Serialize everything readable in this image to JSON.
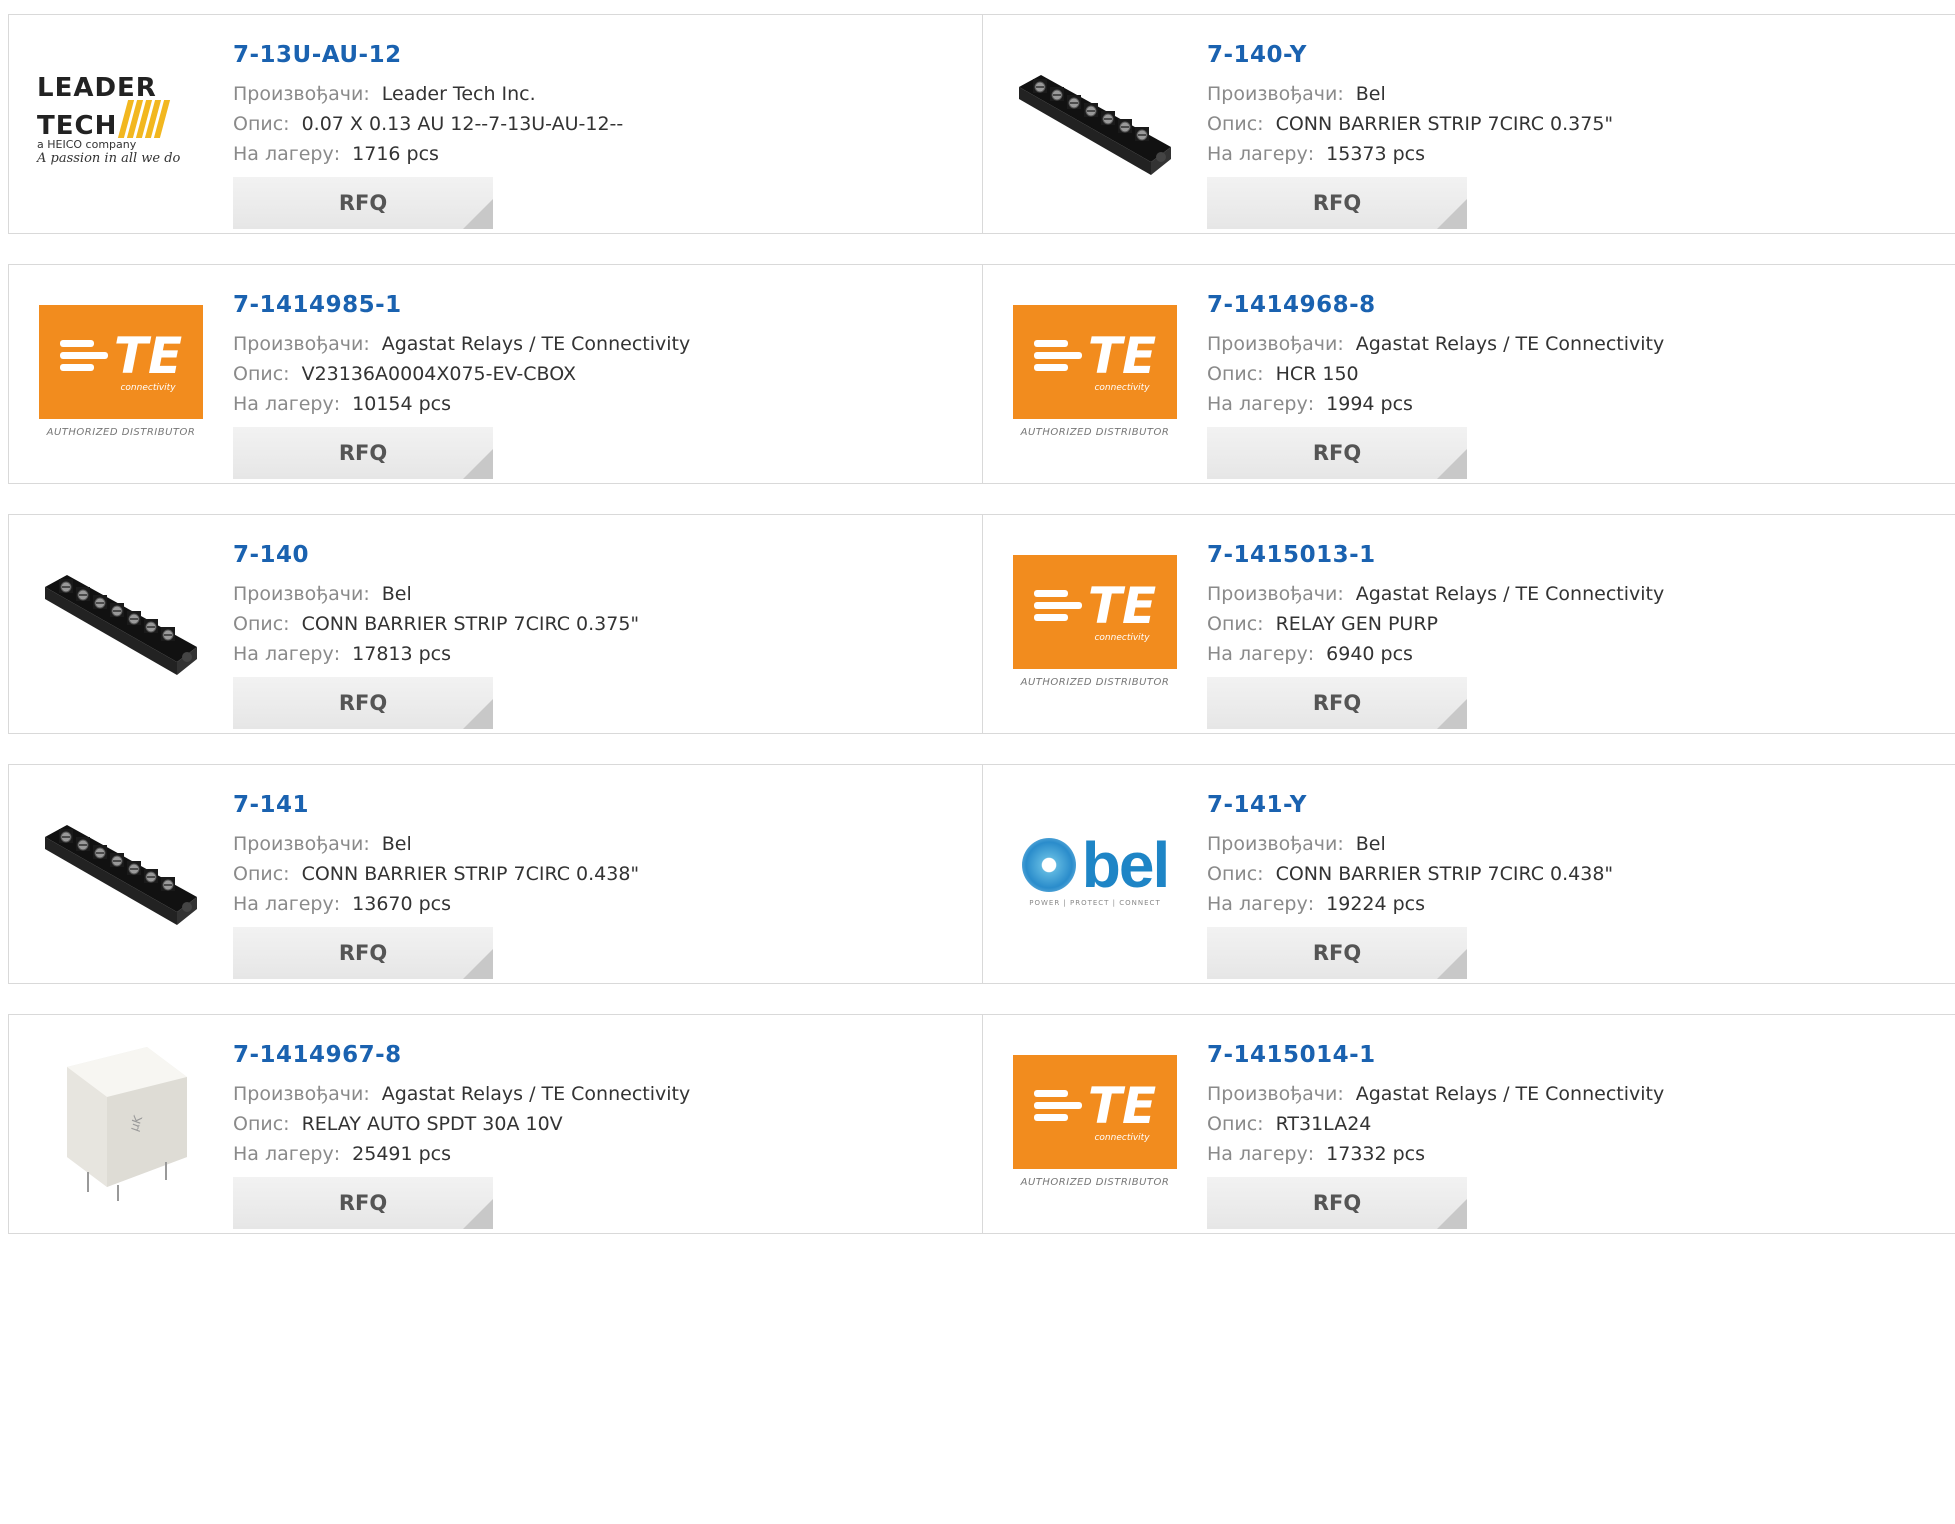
{
  "labels": {
    "manufacturer": "Произвођачи:",
    "description": "Опис:",
    "stock": "На лагеру:",
    "rfq": "RFQ"
  },
  "brand_colors": {
    "part_link": "#1a62b0",
    "te_orange": "#f28c1e",
    "bel_blue": "#1e85c6"
  },
  "logos": {
    "te": {
      "letters": "TE",
      "sub": "connectivity",
      "authorized": "AUTHORIZED DISTRIBUTOR"
    },
    "leader": {
      "line1": "LEADER",
      "line2": "TECH",
      "company": "a HEICO company",
      "tagline": "A passion in all we do"
    },
    "bel": {
      "text": "bel",
      "tagline": "POWER | PROTECT | CONNECT"
    }
  },
  "rows": [
    [
      {
        "part": "7-13U-AU-12",
        "manufacturer": "Leader Tech Inc.",
        "description": "0.07 X 0.13 AU 12--7-13U-AU-12--",
        "stock": "1716 pcs",
        "image": "leader-tech-logo"
      },
      {
        "part": "7-140-Y",
        "manufacturer": "Bel",
        "description": "CONN BARRIER STRIP 7CIRC 0.375\"",
        "stock": "15373 pcs",
        "image": "barrier-strip-photo"
      }
    ],
    [
      {
        "part": "7-1414985-1",
        "manufacturer": "Agastat Relays / TE Connectivity",
        "description": "V23136A0004X075-EV-CBOX",
        "stock": "10154 pcs",
        "image": "te-logo"
      },
      {
        "part": "7-1414968-8",
        "manufacturer": "Agastat Relays / TE Connectivity",
        "description": "HCR 150",
        "stock": "1994 pcs",
        "image": "te-logo"
      }
    ],
    [
      {
        "part": "7-140",
        "manufacturer": "Bel",
        "description": "CONN BARRIER STRIP 7CIRC 0.375\"",
        "stock": "17813 pcs",
        "image": "barrier-strip-photo"
      },
      {
        "part": "7-1415013-1",
        "manufacturer": "Agastat Relays / TE Connectivity",
        "description": "RELAY GEN PURP",
        "stock": "6940 pcs",
        "image": "te-logo"
      }
    ],
    [
      {
        "part": "7-141",
        "manufacturer": "Bel",
        "description": "CONN BARRIER STRIP 7CIRC 0.438\"",
        "stock": "13670 pcs",
        "image": "barrier-strip-photo"
      },
      {
        "part": "7-141-Y",
        "manufacturer": "Bel",
        "description": "CONN BARRIER STRIP 7CIRC 0.438\"",
        "stock": "19224 pcs",
        "image": "bel-logo"
      }
    ],
    [
      {
        "part": "7-1414967-8",
        "manufacturer": "Agastat Relays / TE Connectivity",
        "description": "RELAY AUTO SPDT 30A 10V",
        "stock": "25491 pcs",
        "image": "relay-photo"
      },
      {
        "part": "7-1415014-1",
        "manufacturer": "Agastat Relays / TE Connectivity",
        "description": "RT31LA24",
        "stock": "17332 pcs",
        "image": "te-logo"
      }
    ]
  ]
}
